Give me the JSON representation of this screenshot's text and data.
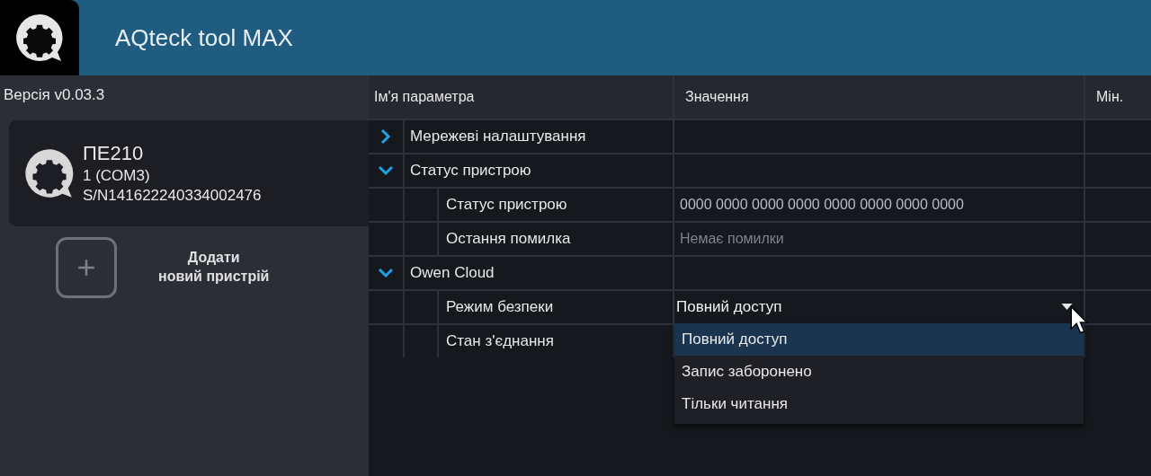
{
  "window": {
    "title": "AQteck tool MAX"
  },
  "sidebar": {
    "version": "Версія v0.03.3",
    "devices": [
      {
        "name": "ПЕ210",
        "port": "1 (COM3)",
        "serial": "S/N141622240334002476",
        "selected": true
      }
    ],
    "add_button": {
      "label": "Додати\nновий пристрій"
    }
  },
  "table": {
    "columns": [
      "Ім'я параметра",
      "Значення",
      "Мін."
    ],
    "groups": [
      {
        "name": "Мережеві налаштування",
        "expanded": false
      },
      {
        "name": "Статус пристрою",
        "expanded": true,
        "children": [
          {
            "name": "Статус пристрою",
            "kind": "text",
            "value": "0000 0000 0000 0000 0000 0000 0000 0000",
            "muted": false
          },
          {
            "name": "Остання помилка",
            "kind": "text",
            "value": "Немає помилки",
            "muted": true
          }
        ]
      },
      {
        "name": "Owen Cloud",
        "expanded": true,
        "children": [
          {
            "name": "Режим безпеки",
            "kind": "dropdown",
            "value": "Повний доступ",
            "open": true,
            "options": [
              {
                "label": "Повний доступ",
                "selected": true
              },
              {
                "label": "Запис заборонено",
                "selected": false
              },
              {
                "label": "Тільки читання",
                "selected": false
              }
            ]
          },
          {
            "name": "Стан з'єднання",
            "kind": "hidden"
          }
        ]
      }
    ]
  }
}
